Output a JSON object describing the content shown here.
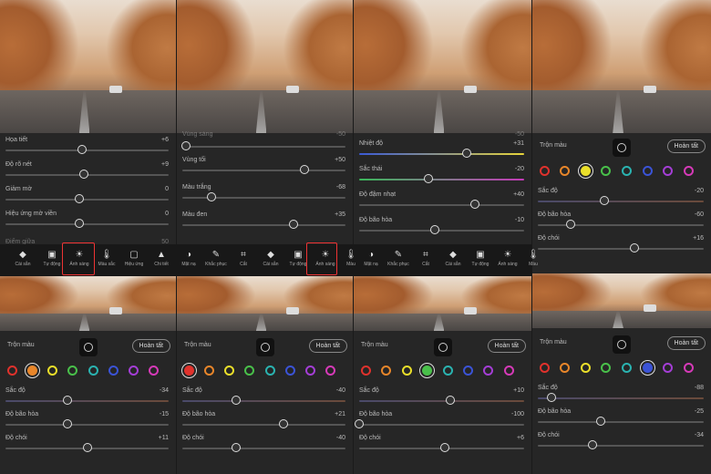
{
  "top_panels": {
    "p1": {
      "sliders": [
        {
          "label": "Họa tiết",
          "value": "+6",
          "pos": 0.47
        },
        {
          "label": "Độ rõ nét",
          "value": "+9",
          "pos": 0.48
        },
        {
          "label": "Giảm mờ",
          "value": "0",
          "pos": 0.45
        },
        {
          "label": "Hiệu ứng mờ viền",
          "value": "0",
          "pos": 0.45
        }
      ],
      "partial_label": "Điểm giữa",
      "partial_value": "50"
    },
    "p2": {
      "partial_label": "Vùng sáng",
      "partial_value": "-50",
      "sliders": [
        {
          "label": "Vùng tối",
          "value": "+50",
          "pos": 0.75
        },
        {
          "label": "Màu trắng",
          "value": "-68",
          "pos": 0.18
        },
        {
          "label": "Màu đen",
          "value": "+35",
          "pos": 0.68
        }
      ]
    },
    "p3": {
      "partial_value": "-50",
      "sliders": [
        {
          "label": "Nhiệt độ",
          "value": "+31",
          "pos": 0.65
        },
        {
          "label": "Sắc thái",
          "value": "-20",
          "pos": 0.42
        },
        {
          "label": "Độ đậm nhạt",
          "value": "+40",
          "pos": 0.7
        },
        {
          "label": "Độ bão hòa",
          "value": "-10",
          "pos": 0.46
        }
      ]
    },
    "p4": {
      "header": "Trộn màu",
      "done": "Hoàn tất",
      "selected": 2,
      "sliders": [
        {
          "label": "Sắc độ",
          "value": "-20",
          "pos": 0.4
        },
        {
          "label": "Độ bão hòa",
          "value": "-60",
          "pos": 0.2
        },
        {
          "label": "Độ chói",
          "value": "+16",
          "pos": 0.58
        }
      ]
    }
  },
  "toolbar": {
    "items": [
      {
        "label": "Cài sẵn",
        "icon": "eraser-icon",
        "glyph": "◆"
      },
      {
        "label": "Tự động",
        "icon": "auto-icon",
        "glyph": "▣"
      },
      {
        "label": "Ánh sáng",
        "icon": "sun-icon",
        "glyph": "☀"
      },
      {
        "label": "Màu sắc",
        "icon": "thermometer-icon",
        "glyph": "🌡"
      },
      {
        "label": "Hiệu ứng",
        "icon": "effects-icon",
        "glyph": "▢"
      },
      {
        "label": "Chi tiết",
        "icon": "triangle-icon",
        "glyph": "▲"
      },
      {
        "label": "Mặt nạ",
        "icon": "mask-icon",
        "glyph": "◑"
      },
      {
        "label": "Khắc phục",
        "icon": "brush-icon",
        "glyph": "✎"
      },
      {
        "label": "Cắt",
        "icon": "crop-icon",
        "glyph": "⌗"
      },
      {
        "label": "Cài sẵn",
        "icon": "eraser-icon",
        "glyph": "◆"
      },
      {
        "label": "Tự động",
        "icon": "auto-icon",
        "glyph": "▣"
      },
      {
        "label": "Ánh sáng",
        "icon": "sun-icon",
        "glyph": "☀"
      },
      {
        "label": "Màu",
        "icon": "thermometer-icon",
        "glyph": "🌡"
      },
      {
        "label": "Mặt nạ",
        "icon": "mask-icon",
        "glyph": "◑"
      },
      {
        "label": "Khắc phục",
        "icon": "brush-icon",
        "glyph": "✎"
      },
      {
        "label": "Cắt",
        "icon": "crop-icon",
        "glyph": "⌗"
      },
      {
        "label": "Cài sẵn",
        "icon": "eraser-icon",
        "glyph": "◆"
      },
      {
        "label": "Tự động",
        "icon": "auto-icon",
        "glyph": "▣"
      },
      {
        "label": "Ánh sáng",
        "icon": "sun-icon",
        "glyph": "☀"
      },
      {
        "label": "Màu",
        "icon": "thermometer-icon",
        "glyph": "🌡"
      }
    ]
  },
  "color_dots": [
    "#e0322c",
    "#e8862a",
    "#eadf2a",
    "#49c04a",
    "#2ab3b0",
    "#3b53d6",
    "#a43ed6",
    "#d63ab8"
  ],
  "bottom_panels": [
    {
      "header": "Trộn màu",
      "done": "Hoàn tất",
      "selected": 1,
      "sliders": [
        {
          "label": "Sắc độ",
          "value": "-34",
          "pos": 0.38
        },
        {
          "label": "Độ bão hòa",
          "value": "-15",
          "pos": 0.38
        },
        {
          "label": "Độ chói",
          "value": "+11",
          "pos": 0.5
        }
      ]
    },
    {
      "header": "Trộn màu",
      "done": "Hoàn tất",
      "selected": 0,
      "sliders": [
        {
          "label": "Sắc độ",
          "value": "-40",
          "pos": 0.33
        },
        {
          "label": "Độ bão hòa",
          "value": "+21",
          "pos": 0.62
        },
        {
          "label": "Độ chói",
          "value": "-40",
          "pos": 0.33
        }
      ]
    },
    {
      "header": "Trộn màu",
      "done": "Hoàn tất",
      "selected": 3,
      "sliders": [
        {
          "label": "Sắc độ",
          "value": "+10",
          "pos": 0.55
        },
        {
          "label": "Độ bão hòa",
          "value": "-100",
          "pos": 0.0
        },
        {
          "label": "Độ chói",
          "value": "+6",
          "pos": 0.52
        }
      ]
    },
    {
      "header": "Trộn màu",
      "done": "Hoàn tất",
      "selected": 5,
      "sliders": [
        {
          "label": "Sắc độ",
          "value": "-88",
          "pos": 0.08
        },
        {
          "label": "Độ bão hòa",
          "value": "-25",
          "pos": 0.38
        },
        {
          "label": "Độ chói",
          "value": "-34",
          "pos": 0.33
        }
      ]
    }
  ]
}
